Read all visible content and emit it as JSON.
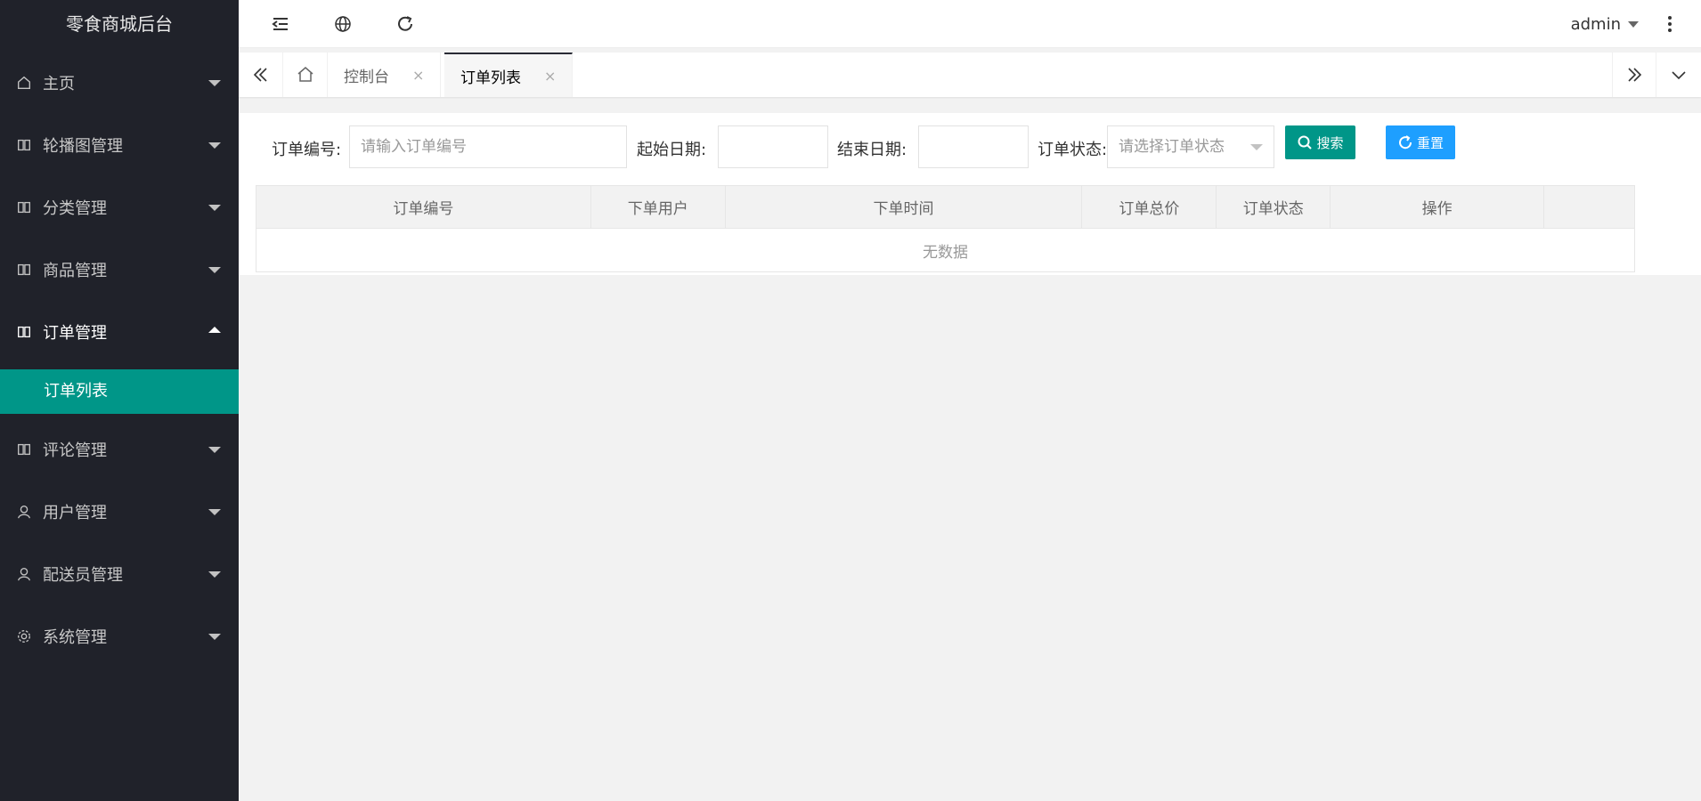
{
  "app": {
    "title": "零食商城后台"
  },
  "sidebar": {
    "items": [
      {
        "label": "主页",
        "icon": "home-icon"
      },
      {
        "label": "轮播图管理",
        "icon": "book-icon"
      },
      {
        "label": "分类管理",
        "icon": "book-icon"
      },
      {
        "label": "商品管理",
        "icon": "book-icon"
      },
      {
        "label": "订单管理",
        "icon": "book-icon"
      },
      {
        "label": "评论管理",
        "icon": "book-icon"
      },
      {
        "label": "用户管理",
        "icon": "user-icon"
      },
      {
        "label": "配送员管理",
        "icon": "user-icon"
      },
      {
        "label": "系统管理",
        "icon": "gear-icon"
      }
    ],
    "sub_item": {
      "label": "订单列表"
    }
  },
  "header": {
    "user": "admin"
  },
  "tabs": [
    {
      "label": "控制台",
      "close": "×"
    },
    {
      "label": "订单列表",
      "close": "×"
    }
  ],
  "filters": {
    "order_no_label": "订单编号:",
    "order_no_placeholder": "请输入订单编号",
    "start_date_label": "起始日期:",
    "end_date_label": "结束日期:",
    "status_label": "订单状态:",
    "status_placeholder": "请选择订单状态",
    "search_button": "搜索",
    "reset_button": "重置"
  },
  "table": {
    "columns": [
      "订单编号",
      "下单用户",
      "下单时间",
      "订单总价",
      "订单状态",
      "操作",
      ""
    ],
    "empty_text": "无数据"
  },
  "colors": {
    "sidebar_bg": "#20222a",
    "accent_green": "#009688",
    "accent_blue": "#1e9fff"
  }
}
